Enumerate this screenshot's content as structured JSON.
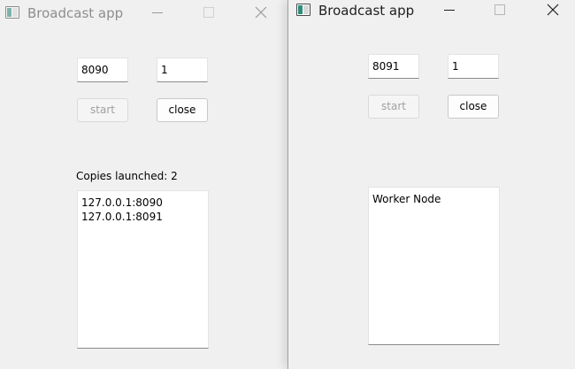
{
  "left_window": {
    "title": "Broadcast app",
    "port_value": "8090",
    "count_value": "1",
    "start_label": "start",
    "close_label": "close",
    "copies_label": "Copies launched: 2",
    "list_items": [
      "127.0.0.1:8090",
      "127.0.0.1:8091"
    ],
    "state": "inactive"
  },
  "right_window": {
    "title": "Broadcast app",
    "port_value": "8091",
    "count_value": "1",
    "start_label": "start",
    "close_label": "close",
    "list_items": [
      "Worker Node"
    ],
    "state": "active"
  },
  "icons": {
    "app": "app-window-icon",
    "minimize": "minimize-icon",
    "maximize": "maximize-icon",
    "close": "close-icon"
  }
}
